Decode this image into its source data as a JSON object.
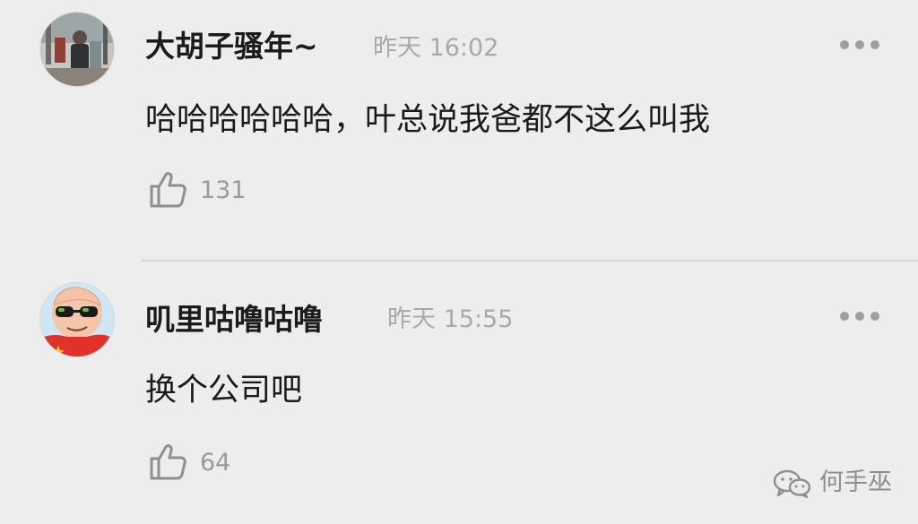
{
  "comments": [
    {
      "username": "大胡子骚年~",
      "time": "昨天 16:02",
      "text": "哈哈哈哈哈哈，叶总说我爸都不这么叫我",
      "likes": "131",
      "avatar_icon": "person-photo-avatar",
      "more_icon": "more-dots-icon",
      "like_icon": "thumbs-up-icon"
    },
    {
      "username": "叽里咕噜咕噜",
      "time": "昨天 15:55",
      "text": "换个公司吧",
      "likes": "64",
      "avatar_icon": "cartoon-sunglasses-avatar",
      "more_icon": "more-dots-icon",
      "like_icon": "thumbs-up-icon"
    }
  ],
  "watermark": {
    "text": "何手巫",
    "icon": "wechat-logo-icon"
  },
  "colors": {
    "background": "#ededed",
    "username": "#1b1b1b",
    "secondary_text": "#a9a9a9",
    "divider": "#d6d6d6"
  }
}
